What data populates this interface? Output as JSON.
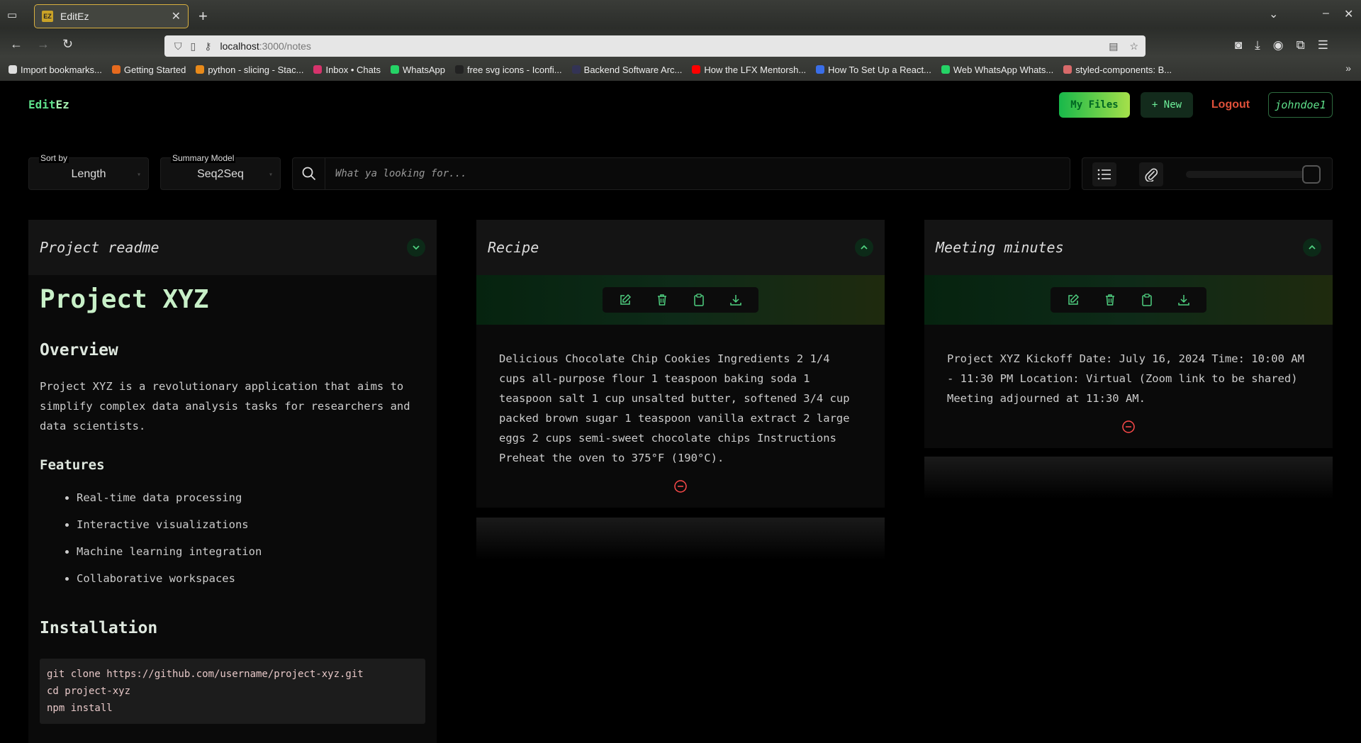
{
  "browser": {
    "tab_title": "EditEz",
    "favicon_text": "EZ",
    "url_host": "localhost",
    "url_path": ":3000/notes",
    "bookmarks": [
      {
        "label": "Import bookmarks...",
        "color": "#dddddd"
      },
      {
        "label": "Getting Started",
        "color": "#e66a1e"
      },
      {
        "label": "python - slicing - Stac...",
        "color": "#e88a1a"
      },
      {
        "label": "Inbox • Chats",
        "color": "#d6336c"
      },
      {
        "label": "WhatsApp",
        "color": "#25d366"
      },
      {
        "label": "free svg icons - Iconfi...",
        "color": "#222222"
      },
      {
        "label": "Backend Software Arc...",
        "color": "#333355"
      },
      {
        "label": "How the LFX Mentorsh...",
        "color": "#ff0000"
      },
      {
        "label": "How To Set Up a React...",
        "color": "#3a6ee8"
      },
      {
        "label": "Web WhatsApp Whats...",
        "color": "#25d366"
      },
      {
        "label": "styled-components: B...",
        "color": "#d86a6a"
      }
    ]
  },
  "app": {
    "brand_prefix": "Edit",
    "brand_suffix": "Ez",
    "nav": {
      "my_files": "My Files",
      "new": "+ New",
      "logout": "Logout",
      "username": "johndoe1"
    },
    "controls": {
      "sort_label": "Sort by",
      "sort_value": "Length",
      "model_label": "Summary Model",
      "model_value": "Seq2Seq",
      "search_placeholder": "What ya looking for..."
    },
    "readme": {
      "title": "Project readme",
      "h1": "Project XYZ",
      "overview_heading": "Overview",
      "overview_text": "Project XYZ is a revolutionary application that aims to simplify complex data analysis tasks for researchers and data scientists.",
      "features_heading": "Features",
      "features": [
        "Real-time data processing",
        "Interactive visualizations",
        "Machine learning integration",
        "Collaborative workspaces"
      ],
      "install_heading": "Installation",
      "install_code": "git clone https://github.com/username/project-xyz.git\ncd project-xyz\nnpm install"
    },
    "notes": [
      {
        "title": "Recipe",
        "text": "Delicious Chocolate Chip Cookies Ingredients 2 1/4 cups all-purpose flour 1 teaspoon baking soda 1 teaspoon salt 1 cup unsalted butter, softened 3/4 cup packed brown sugar 1 teaspoon vanilla extract 2 large eggs 2 cups semi-sweet chocolate chips Instructions Preheat the oven to 375°F (190°C)."
      },
      {
        "title": "Meeting minutes",
        "text": "Project XYZ Kickoff Date: July 16, 2024 Time: 10:00 AM - 11:30 PM Location: Virtual (Zoom link to be shared) Meeting adjourned at 11:30 AM."
      }
    ]
  },
  "colors": {
    "accent": "#5ee08a",
    "danger": "#e0513a",
    "remove": "#ff4a4a"
  }
}
